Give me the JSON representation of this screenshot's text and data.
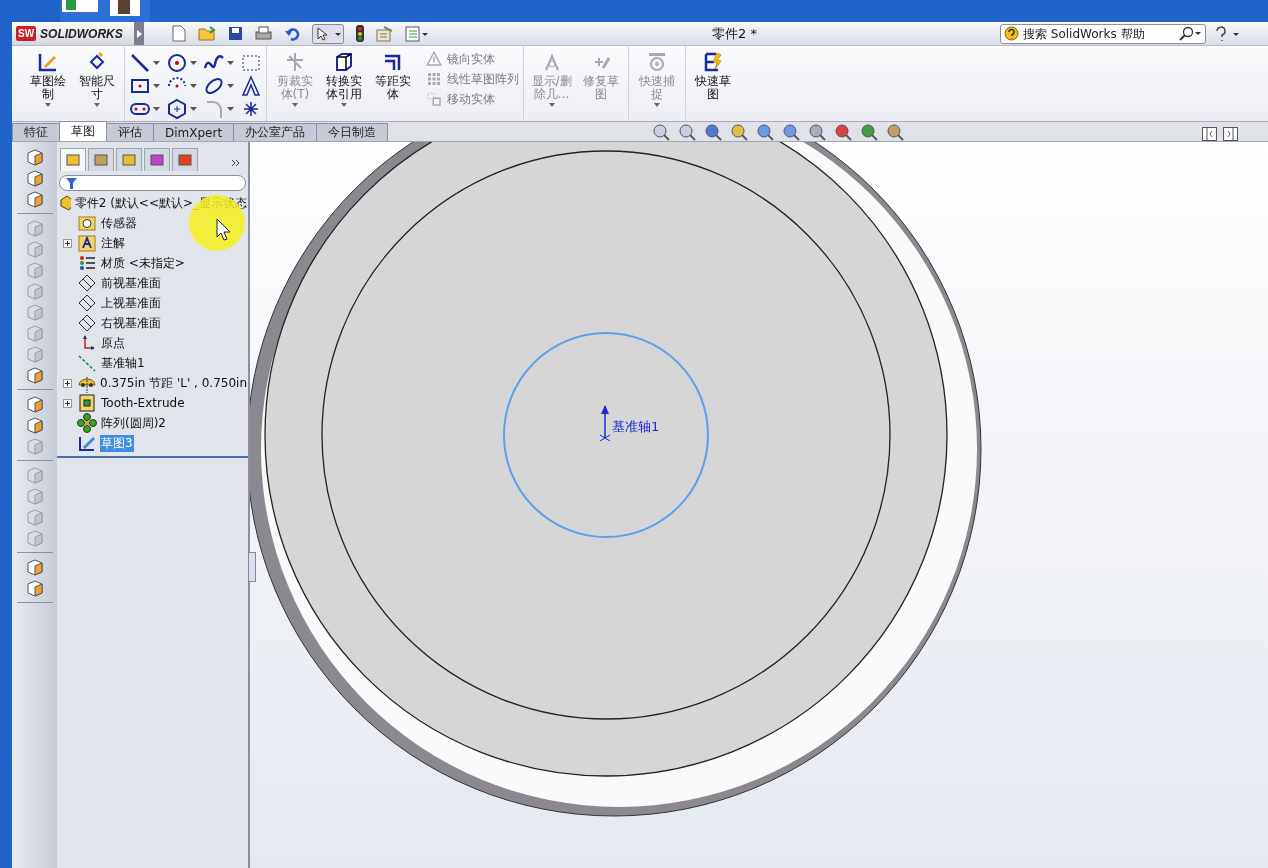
{
  "window": {
    "logo_badge": "SW",
    "logo": "SOLIDWORKS",
    "title": "零件2 *"
  },
  "search": {
    "placeholder": "搜索 SolidWorks 帮助"
  },
  "ribbon": {
    "groups": [
      {
        "items": [
          {
            "kind": "big",
            "label": "草图绘制",
            "disabled": false,
            "caret": true
          },
          {
            "kind": "big",
            "label": "智能尺寸",
            "disabled": false,
            "caret": true
          }
        ]
      },
      {
        "items": [
          {
            "kind": "tools"
          }
        ]
      },
      {
        "items": [
          {
            "kind": "big",
            "label": "剪裁实体(T)",
            "disabled": true,
            "caret": true
          },
          {
            "kind": "big",
            "label": "转换实体引用",
            "disabled": false,
            "caret": true
          },
          {
            "kind": "big",
            "label": "等距实体",
            "disabled": false,
            "caret": false
          },
          {
            "kind": "small",
            "entries": [
              {
                "label": "镜向实体",
                "disabled": true
              },
              {
                "label": "线性草图阵列",
                "disabled": true
              },
              {
                "label": "移动实体",
                "disabled": true
              }
            ]
          }
        ]
      },
      {
        "items": [
          {
            "kind": "big",
            "label": "显示/删除几…",
            "disabled": true,
            "caret": true
          },
          {
            "kind": "big",
            "label": "修复草图",
            "disabled": true,
            "caret": false
          }
        ]
      },
      {
        "items": [
          {
            "kind": "big",
            "label": "快速捕捉",
            "disabled": true,
            "caret": true
          }
        ]
      },
      {
        "items": [
          {
            "kind": "big",
            "label": "快速草图",
            "disabled": false,
            "caret": false
          }
        ]
      }
    ]
  },
  "panel_tabs": [
    {
      "selected": true
    },
    {
      "selected": false
    },
    {
      "selected": false
    },
    {
      "selected": false
    },
    {
      "selected": false
    }
  ],
  "tabs": [
    {
      "label": "特征",
      "selected": false
    },
    {
      "label": "草图",
      "selected": true
    },
    {
      "label": "评估",
      "selected": false
    },
    {
      "label": "DimXpert",
      "selected": false
    },
    {
      "label": "办公室产品",
      "selected": false
    },
    {
      "label": "今日制造",
      "selected": false
    }
  ],
  "left_toolbar": [
    {
      "kind": "tool",
      "disabled": false
    },
    {
      "kind": "tool",
      "disabled": false
    },
    {
      "kind": "tool",
      "disabled": false
    },
    {
      "kind": "separator"
    },
    {
      "kind": "tool",
      "disabled": true
    },
    {
      "kind": "tool",
      "disabled": true
    },
    {
      "kind": "tool",
      "disabled": true
    },
    {
      "kind": "tool",
      "disabled": true
    },
    {
      "kind": "tool",
      "disabled": true
    },
    {
      "kind": "tool",
      "disabled": true
    },
    {
      "kind": "tool",
      "disabled": true
    },
    {
      "kind": "tool",
      "disabled": false
    },
    {
      "kind": "separator"
    },
    {
      "kind": "tool",
      "disabled": false
    },
    {
      "kind": "tool",
      "disabled": false
    },
    {
      "kind": "tool",
      "disabled": true
    },
    {
      "kind": "separator"
    },
    {
      "kind": "tool",
      "disabled": true
    },
    {
      "kind": "tool",
      "disabled": true
    },
    {
      "kind": "tool",
      "disabled": true
    },
    {
      "kind": "tool",
      "disabled": true
    },
    {
      "kind": "separator"
    },
    {
      "kind": "tool",
      "disabled": false
    },
    {
      "kind": "tool",
      "disabled": false
    },
    {
      "kind": "separator"
    }
  ],
  "tree": {
    "label": "零件2 (默认<<默认>_显示状态",
    "children": [
      {
        "kind": "sensor",
        "label": "传感器",
        "expandable": false,
        "selected": false
      },
      {
        "kind": "annotation",
        "label": "注解",
        "expandable": true,
        "selected": false
      },
      {
        "kind": "material",
        "label": "材质 <未指定>",
        "expandable": false,
        "selected": false
      },
      {
        "kind": "plane",
        "label": "前视基准面",
        "expandable": false,
        "selected": false
      },
      {
        "kind": "plane",
        "label": "上视基准面",
        "expandable": false,
        "selected": false
      },
      {
        "kind": "plane",
        "label": "右视基准面",
        "expandable": false,
        "selected": false
      },
      {
        "kind": "origin",
        "label": "原点",
        "expandable": false,
        "selected": false
      },
      {
        "kind": "axis",
        "label": "基准轴1",
        "expandable": false,
        "selected": false
      },
      {
        "kind": "gear",
        "label": "0.375in 节距 'L'  , 0.750in",
        "expandable": true,
        "selected": false
      },
      {
        "kind": "extrude",
        "label": "Tooth-Extrude",
        "expandable": true,
        "selected": false
      },
      {
        "kind": "pattern",
        "label": "阵列(圆周)2",
        "expandable": false,
        "selected": false
      },
      {
        "kind": "sketch",
        "label": "草图3",
        "expandable": false,
        "selected": true
      }
    ]
  },
  "graphics": {
    "axis_label": "基准轴1"
  }
}
